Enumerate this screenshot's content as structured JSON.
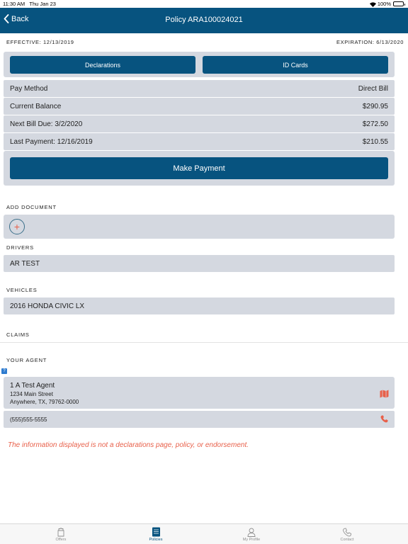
{
  "status_bar": {
    "time": "11:30 AM",
    "date": "Thu Jan 23",
    "battery": "100%"
  },
  "nav": {
    "back_label": "Back",
    "title": "Policy ARA100024021"
  },
  "dates": {
    "effective": "EFFECTIVE: 12/13/2019",
    "expiration": "EXPIRATION: 6/13/2020"
  },
  "buttons": {
    "declarations": "Declarations",
    "id_cards": "ID Cards",
    "make_payment": "Make Payment"
  },
  "billing": [
    {
      "label": "Pay Method",
      "value": "Direct Bill"
    },
    {
      "label": "Current Balance",
      "value": "$290.95"
    },
    {
      "label": "Next Bill Due: 3/2/2020",
      "value": "$272.50"
    },
    {
      "label": "Last Payment: 12/16/2019",
      "value": "$210.55"
    }
  ],
  "sections": {
    "add_document": "ADD DOCUMENT",
    "drivers": "DRIVERS",
    "vehicles": "VEHICLES",
    "claims": "CLAIMS",
    "your_agent": "YOUR AGENT"
  },
  "add_symbol": "+",
  "drivers": [
    "AR TEST"
  ],
  "vehicles": [
    "2016 HONDA CIVIC LX"
  ],
  "agent": {
    "name": "1 A Test Agent",
    "address1": "1234 Main Street",
    "address2": "Anywhere, TX, 79762-0000",
    "phone": "(555)555-5555"
  },
  "help_badge": "?",
  "disclaimer": "The information displayed is not a declarations page, policy, or endorsement.",
  "tabs": [
    {
      "label": "Offers"
    },
    {
      "label": "Policies"
    },
    {
      "label": "My Profile"
    },
    {
      "label": "Contact"
    }
  ],
  "colors": {
    "primary": "#07537f",
    "card": "#d4d8e0",
    "accent": "#e8604a"
  }
}
